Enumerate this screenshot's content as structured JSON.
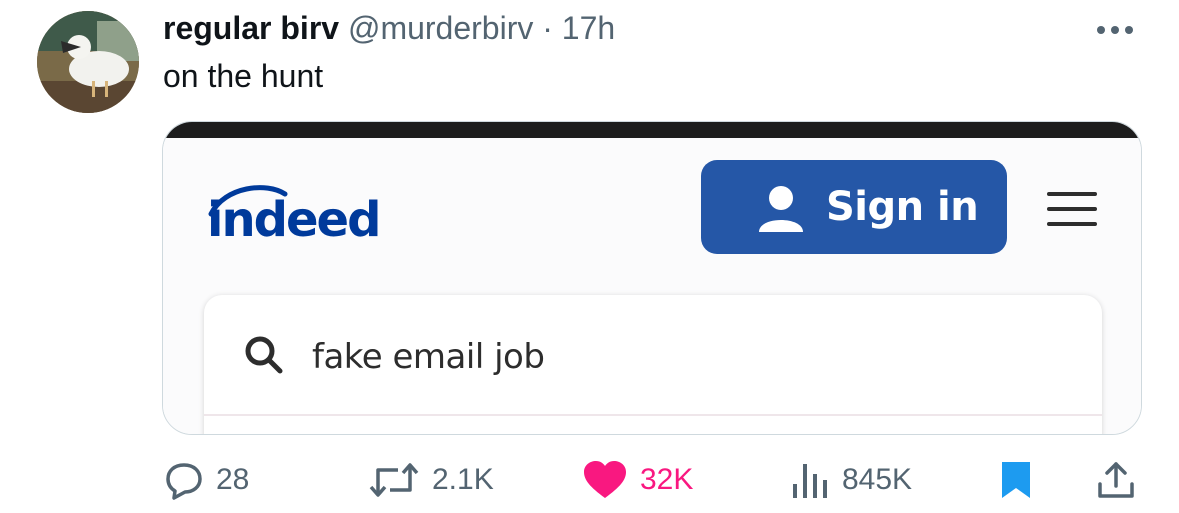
{
  "tweet": {
    "display_name": "regular birv",
    "handle": "@murderbirv",
    "separator": "·",
    "time": "17h",
    "text": "on the hunt"
  },
  "media": {
    "brand_name": "indeed",
    "signin_label": "Sign in",
    "search_value": "fake email job",
    "brand_color": "#2557a7",
    "logo_color": "#003a9b"
  },
  "actions": {
    "replies": "28",
    "retweets": "2.1K",
    "likes": "32K",
    "views": "845K"
  },
  "colors": {
    "like": "#f91880",
    "bookmark": "#1d9bf0",
    "muted": "#536471"
  },
  "icons": [
    "more-icon",
    "person-icon",
    "hamburger-icon",
    "search-icon",
    "reply-icon",
    "retweet-icon",
    "heart-icon",
    "views-icon",
    "bookmark-icon",
    "share-icon"
  ]
}
